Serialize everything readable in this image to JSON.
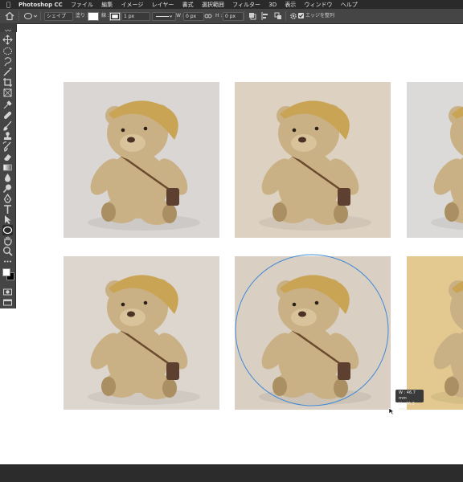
{
  "menubar": {
    "app_name": "Photoshop CC",
    "items": [
      "ファイル",
      "編集",
      "イメージ",
      "レイヤー",
      "書式",
      "選択範囲",
      "フィルター",
      "3D",
      "表示",
      "ウィンドウ",
      "ヘルプ"
    ]
  },
  "options_bar": {
    "mode_value": "シェイプ",
    "fill_label": "塗り :",
    "stroke_label": "線 :",
    "stroke_width": "1 px",
    "width_label": "W :",
    "width_value": "0 px",
    "height_label": "H :",
    "height_value": "0 px",
    "align_edges_label": "エッジを整列",
    "align_edges_checked": true
  },
  "tooltip": {
    "width": "W : 46.7 mm",
    "height": "H : 46.2 mm"
  },
  "colors": {
    "menubar_bg": "#2a2a2a",
    "panel_bg": "#454545",
    "ellipse_stroke": "#3f8ad8",
    "photo_tones": [
      "#d9d6d4",
      "#ddd2c2",
      "#dcdad8",
      "#ddd6cf",
      "#d9cfc2",
      "#e3c98f"
    ]
  },
  "tools": [
    "move-icon",
    "marquee-ellipse-icon",
    "lasso-icon",
    "magic-wand-icon",
    "crop-icon",
    "frame-icon",
    "eyedropper-icon",
    "healing-brush-icon",
    "brush-icon",
    "stamp-icon",
    "history-brush-icon",
    "eraser-icon",
    "gradient-icon",
    "blur-icon",
    "dodge-icon",
    "pen-icon",
    "type-icon",
    "path-selection-icon",
    "ellipse-tool-icon",
    "hand-icon",
    "zoom-icon",
    "more-tools-icon"
  ]
}
